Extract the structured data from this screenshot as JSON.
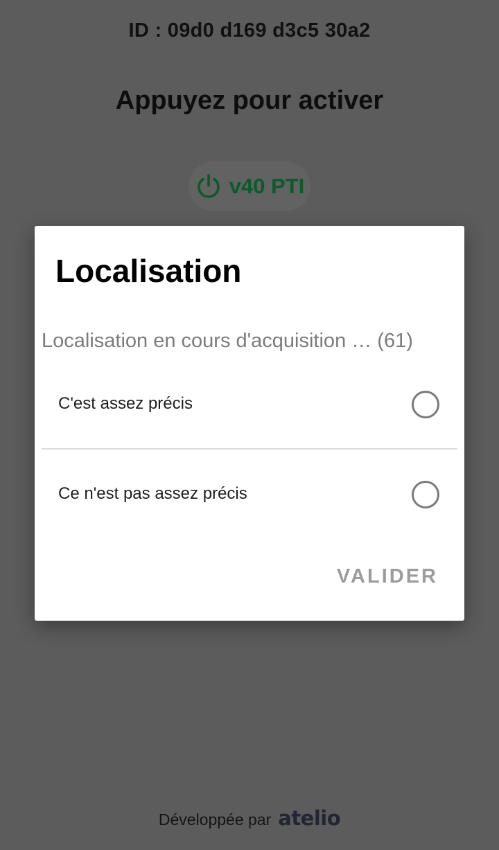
{
  "device": {
    "id_text": "ID : 09d0 d169 d3c5 30a2"
  },
  "main": {
    "headline": "Appuyez pour activer",
    "activate_button": {
      "label": "v40 PTI",
      "icon": "power-icon",
      "color": "#0c5a2a"
    }
  },
  "dialog": {
    "title": "Localisation",
    "message": "Localisation en cours d'acquisition … (61)",
    "options": [
      {
        "label": "C'est assez précis",
        "selected": false
      },
      {
        "label": "Ce n'est pas assez précis",
        "selected": false
      }
    ],
    "validate_label": "VALIDER"
  },
  "footer": {
    "text": "Développée par",
    "brand": "atelio"
  }
}
